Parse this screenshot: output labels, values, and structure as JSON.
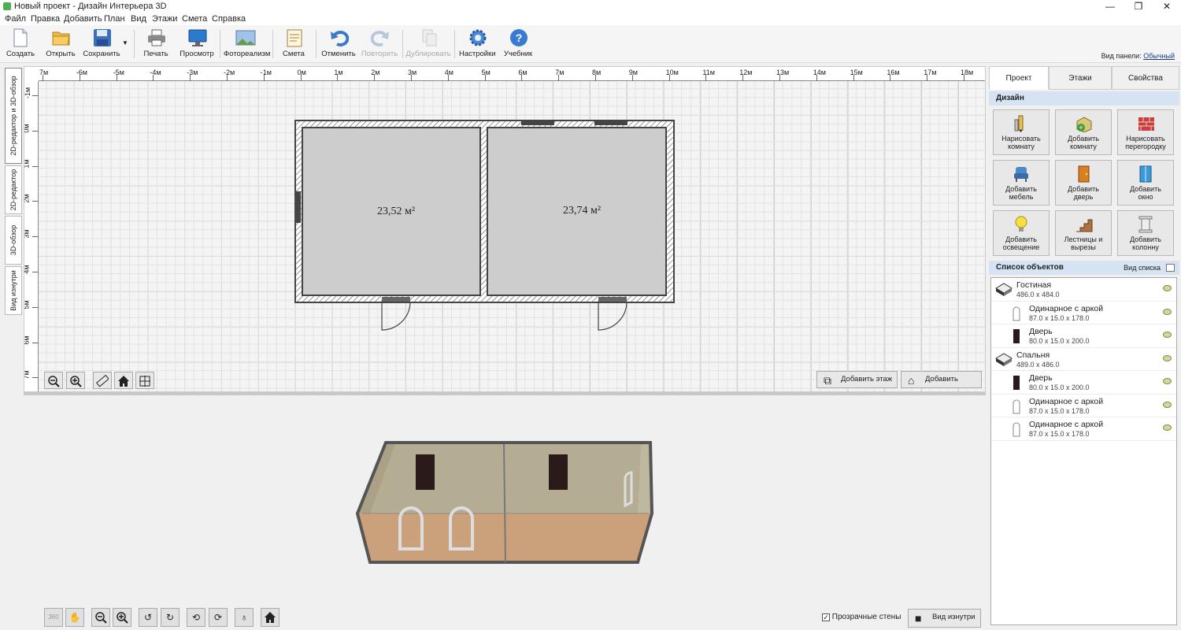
{
  "window": {
    "title": "Новый проект - Дизайн Интерьера 3D",
    "min": "—",
    "max": "❐",
    "close": "✕"
  },
  "menu": [
    "Файл",
    "Правка",
    "Добавить",
    "План",
    "Вид",
    "Этажи",
    "Смета",
    "Справка"
  ],
  "toolbar": {
    "create": "Создать",
    "open": "Открыть",
    "save": "Сохранить",
    "print": "Печать",
    "preview": "Просмотр",
    "photo": "Фотореализм",
    "estimate": "Смета",
    "undo": "Отменить",
    "redo": "Повторить",
    "duplicate": "Дублировать",
    "settings": "Настройки",
    "tutorial": "Учебник"
  },
  "panel_view": {
    "label": "Вид панели:",
    "value": "Обычный"
  },
  "left_tabs": [
    "2D-редактор и 3D-обзор",
    "2D-редактор",
    "3D-обзор",
    "Вид изнутри"
  ],
  "ruler": {
    "h": [
      "7м",
      "-6м",
      "-5м",
      "-4м",
      "-3м",
      "-2м",
      "-1м",
      "0м",
      "1м",
      "2м",
      "3м",
      "4м",
      "5м",
      "6м",
      "7м",
      "8м",
      "9м",
      "10м",
      "11м",
      "12м",
      "13м",
      "14м",
      "15м",
      "16м",
      "17м",
      "18м"
    ],
    "v": [
      "-1м",
      "0м",
      "1м",
      "2м",
      "3м",
      "4м",
      "5м",
      "6м",
      "7м"
    ]
  },
  "rooms": [
    {
      "area": "23,52 м²"
    },
    {
      "area": "23,74 м²"
    }
  ],
  "plan_buttons": {
    "add_floor": "Добавить этаж",
    "add_roof": "Добавить крышу"
  },
  "view3d": {
    "transparent_walls": "Прозрачные стены",
    "inside_view": "Вид изнутри",
    "rot_label": "360"
  },
  "right_panel": {
    "tabs": [
      "Проект",
      "Этажи",
      "Свойства"
    ],
    "design_title": "Дизайн",
    "design_buttons": [
      [
        "Нарисовать",
        "комнату"
      ],
      [
        "Добавить",
        "комнату"
      ],
      [
        "Нарисовать",
        "перегородку"
      ],
      [
        "Добавить",
        "мебель"
      ],
      [
        "Добавить",
        "дверь"
      ],
      [
        "Добавить",
        "окно"
      ],
      [
        "Добавить",
        "освещение"
      ],
      [
        "Лестницы и",
        "вырезы"
      ],
      [
        "Добавить",
        "колонну"
      ]
    ],
    "objects_title": "Список объектов",
    "list_view": "Вид списка",
    "objects": [
      {
        "name": "Гостиная",
        "dims": "486.0 x 484.0",
        "kind": "room"
      },
      {
        "name": "Одинарное с аркой",
        "dims": "87.0 x 15.0 x 178.0",
        "kind": "window"
      },
      {
        "name": "Дверь",
        "dims": "80.0 x 15.0 x 200.0",
        "kind": "door"
      },
      {
        "name": "Спальня",
        "dims": "489.0 x 486.0",
        "kind": "room"
      },
      {
        "name": "Дверь",
        "dims": "80.0 x 15.0 x 200.0",
        "kind": "door"
      },
      {
        "name": "Одинарное с аркой",
        "dims": "87.0 x 15.0 x 178.0",
        "kind": "window"
      },
      {
        "name": "Одинарное с аркой",
        "dims": "87.0 x 15.0 x 178.0",
        "kind": "window"
      }
    ]
  },
  "colors": {
    "accent": "#2a6ab5",
    "section_header": "#d5e3f3",
    "room_fill": "#cdcdcd",
    "wall": "#555555"
  }
}
